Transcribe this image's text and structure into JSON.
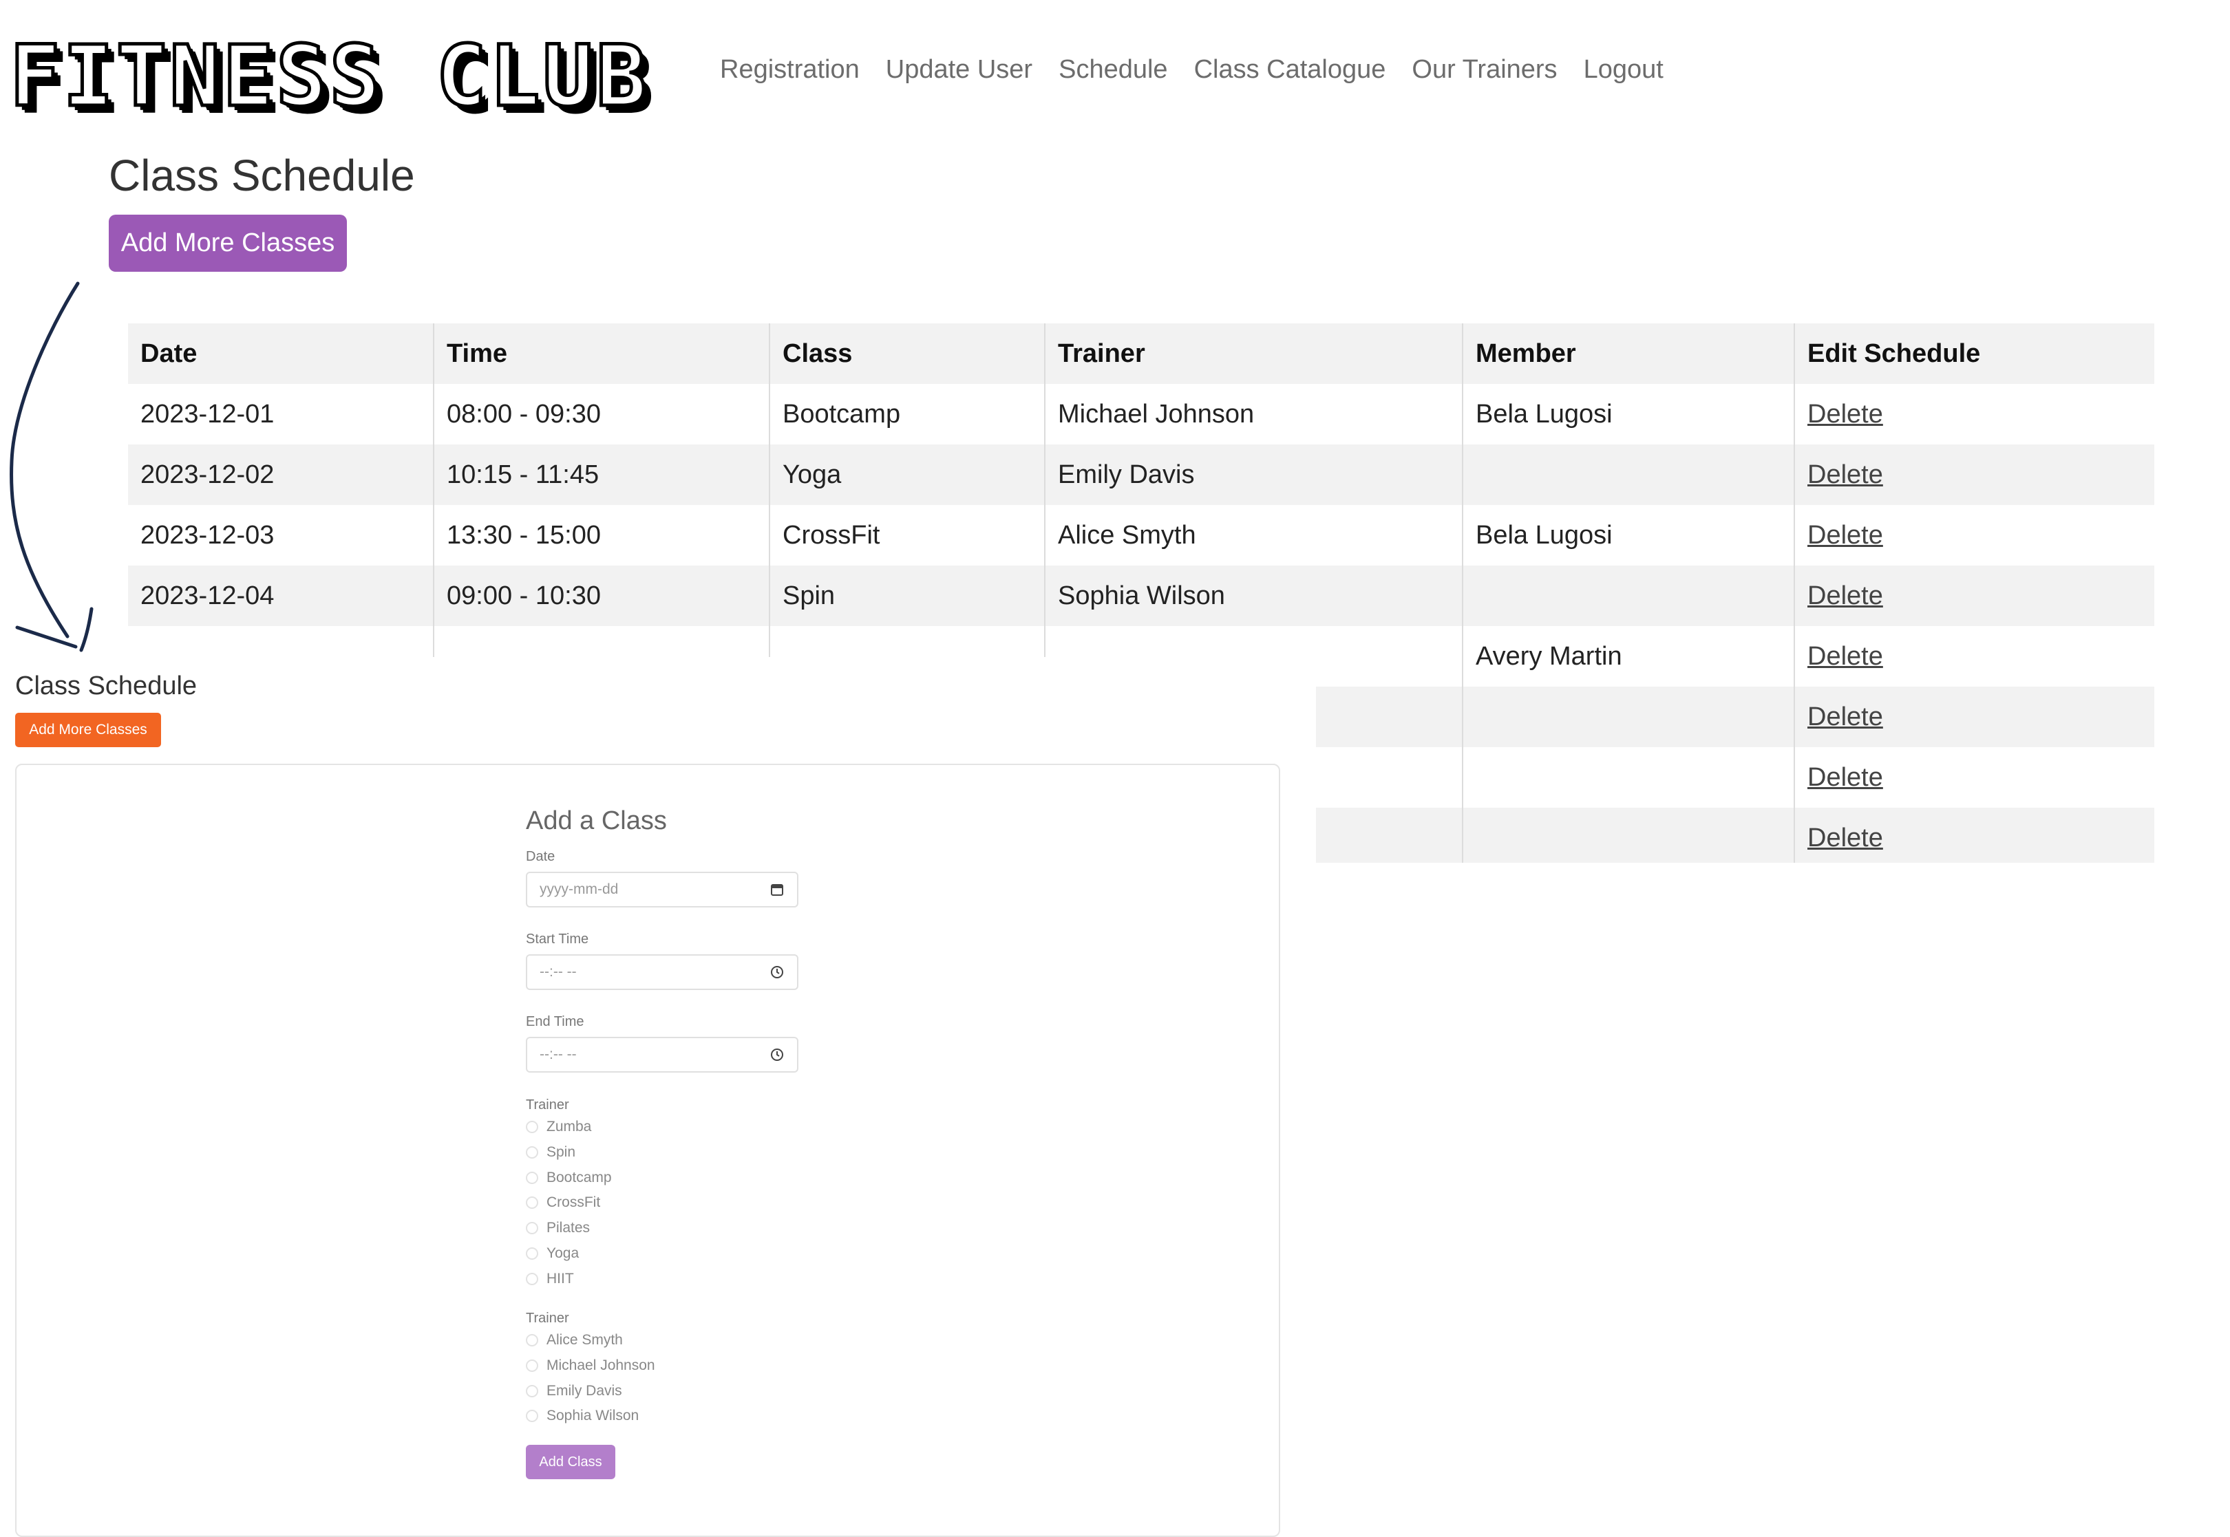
{
  "brand": {
    "logo": "FITNESS CLUB"
  },
  "nav": {
    "items": [
      "Registration",
      "Update User",
      "Schedule",
      "Class Catalogue",
      "Our Trainers",
      "Logout"
    ]
  },
  "main": {
    "title": "Class Schedule",
    "add_more_label": "Add More Classes"
  },
  "table": {
    "headers": [
      "Date",
      "Time",
      "Class",
      "Trainer",
      "Member",
      "Edit Schedule"
    ],
    "rows": [
      [
        "2023-12-01",
        "08:00 - 09:30",
        "Bootcamp",
        "Michael Johnson",
        "Bela Lugosi",
        "Delete"
      ],
      [
        "2023-12-02",
        "10:15 - 11:45",
        "Yoga",
        "Emily Davis",
        "",
        "Delete"
      ],
      [
        "2023-12-03",
        "13:30 - 15:00",
        "CrossFit",
        "Alice Smyth",
        "Bela Lugosi",
        "Delete"
      ],
      [
        "2023-12-04",
        "09:00 - 10:30",
        "Spin",
        "Sophia Wilson",
        "",
        "Delete"
      ],
      [
        "",
        "",
        "",
        "",
        "Avery Martin",
        "Delete"
      ],
      [
        "",
        "",
        "",
        "",
        "",
        "Delete"
      ],
      [
        "",
        "",
        "",
        "",
        "",
        "Delete"
      ],
      [
        "",
        "",
        "",
        "",
        "",
        "Delete"
      ]
    ]
  },
  "inset": {
    "title": "Class Schedule",
    "add_more_label": "Add More Classes",
    "form": {
      "title": "Add a Class",
      "date_label": "Date",
      "date_placeholder": "yyyy-mm-dd",
      "start_label": "Start Time",
      "start_placeholder": "--:-- --",
      "end_label": "End Time",
      "end_placeholder": "--:-- --",
      "class_label": "Trainer",
      "class_options": [
        "Zumba",
        "Spin",
        "Bootcamp",
        "CrossFit",
        "Pilates",
        "Yoga",
        "HIIT"
      ],
      "trainer_label": "Trainer",
      "trainer_options": [
        "Alice Smyth",
        "Michael Johnson",
        "Emily Davis",
        "Sophia Wilson"
      ],
      "submit_label": "Add Class"
    }
  },
  "colors": {
    "primary_button": "#9b59b6",
    "inset_button": "#f26522",
    "form_submit": "#b37fcb",
    "arrow": "#1b2a49",
    "table_stripe": "#f2f2f2"
  },
  "icons": {
    "date": "calendar-icon",
    "time": "clock-icon",
    "annotation": "hand-drawn-arrow"
  }
}
